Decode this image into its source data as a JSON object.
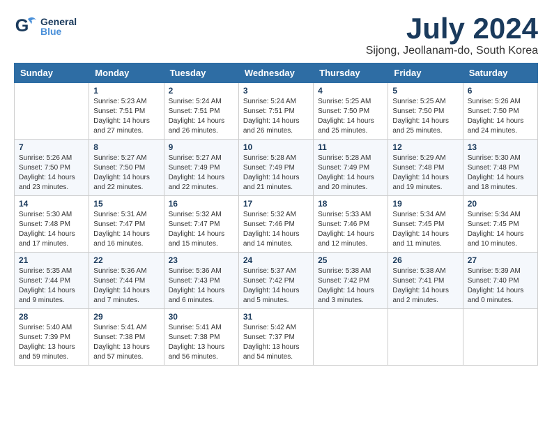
{
  "header": {
    "logo_general": "General",
    "logo_blue": "Blue",
    "month_title": "July 2024",
    "location": "Sijong, Jeollanam-do, South Korea"
  },
  "calendar": {
    "days_of_week": [
      "Sunday",
      "Monday",
      "Tuesday",
      "Wednesday",
      "Thursday",
      "Friday",
      "Saturday"
    ],
    "weeks": [
      [
        {
          "day": "",
          "content": ""
        },
        {
          "day": "1",
          "content": "Sunrise: 5:23 AM\nSunset: 7:51 PM\nDaylight: 14 hours\nand 27 minutes."
        },
        {
          "day": "2",
          "content": "Sunrise: 5:24 AM\nSunset: 7:51 PM\nDaylight: 14 hours\nand 26 minutes."
        },
        {
          "day": "3",
          "content": "Sunrise: 5:24 AM\nSunset: 7:51 PM\nDaylight: 14 hours\nand 26 minutes."
        },
        {
          "day": "4",
          "content": "Sunrise: 5:25 AM\nSunset: 7:50 PM\nDaylight: 14 hours\nand 25 minutes."
        },
        {
          "day": "5",
          "content": "Sunrise: 5:25 AM\nSunset: 7:50 PM\nDaylight: 14 hours\nand 25 minutes."
        },
        {
          "day": "6",
          "content": "Sunrise: 5:26 AM\nSunset: 7:50 PM\nDaylight: 14 hours\nand 24 minutes."
        }
      ],
      [
        {
          "day": "7",
          "content": "Sunrise: 5:26 AM\nSunset: 7:50 PM\nDaylight: 14 hours\nand 23 minutes."
        },
        {
          "day": "8",
          "content": "Sunrise: 5:27 AM\nSunset: 7:50 PM\nDaylight: 14 hours\nand 22 minutes."
        },
        {
          "day": "9",
          "content": "Sunrise: 5:27 AM\nSunset: 7:49 PM\nDaylight: 14 hours\nand 22 minutes."
        },
        {
          "day": "10",
          "content": "Sunrise: 5:28 AM\nSunset: 7:49 PM\nDaylight: 14 hours\nand 21 minutes."
        },
        {
          "day": "11",
          "content": "Sunrise: 5:28 AM\nSunset: 7:49 PM\nDaylight: 14 hours\nand 20 minutes."
        },
        {
          "day": "12",
          "content": "Sunrise: 5:29 AM\nSunset: 7:48 PM\nDaylight: 14 hours\nand 19 minutes."
        },
        {
          "day": "13",
          "content": "Sunrise: 5:30 AM\nSunset: 7:48 PM\nDaylight: 14 hours\nand 18 minutes."
        }
      ],
      [
        {
          "day": "14",
          "content": "Sunrise: 5:30 AM\nSunset: 7:48 PM\nDaylight: 14 hours\nand 17 minutes."
        },
        {
          "day": "15",
          "content": "Sunrise: 5:31 AM\nSunset: 7:47 PM\nDaylight: 14 hours\nand 16 minutes."
        },
        {
          "day": "16",
          "content": "Sunrise: 5:32 AM\nSunset: 7:47 PM\nDaylight: 14 hours\nand 15 minutes."
        },
        {
          "day": "17",
          "content": "Sunrise: 5:32 AM\nSunset: 7:46 PM\nDaylight: 14 hours\nand 14 minutes."
        },
        {
          "day": "18",
          "content": "Sunrise: 5:33 AM\nSunset: 7:46 PM\nDaylight: 14 hours\nand 12 minutes."
        },
        {
          "day": "19",
          "content": "Sunrise: 5:34 AM\nSunset: 7:45 PM\nDaylight: 14 hours\nand 11 minutes."
        },
        {
          "day": "20",
          "content": "Sunrise: 5:34 AM\nSunset: 7:45 PM\nDaylight: 14 hours\nand 10 minutes."
        }
      ],
      [
        {
          "day": "21",
          "content": "Sunrise: 5:35 AM\nSunset: 7:44 PM\nDaylight: 14 hours\nand 9 minutes."
        },
        {
          "day": "22",
          "content": "Sunrise: 5:36 AM\nSunset: 7:44 PM\nDaylight: 14 hours\nand 7 minutes."
        },
        {
          "day": "23",
          "content": "Sunrise: 5:36 AM\nSunset: 7:43 PM\nDaylight: 14 hours\nand 6 minutes."
        },
        {
          "day": "24",
          "content": "Sunrise: 5:37 AM\nSunset: 7:42 PM\nDaylight: 14 hours\nand 5 minutes."
        },
        {
          "day": "25",
          "content": "Sunrise: 5:38 AM\nSunset: 7:42 PM\nDaylight: 14 hours\nand 3 minutes."
        },
        {
          "day": "26",
          "content": "Sunrise: 5:38 AM\nSunset: 7:41 PM\nDaylight: 14 hours\nand 2 minutes."
        },
        {
          "day": "27",
          "content": "Sunrise: 5:39 AM\nSunset: 7:40 PM\nDaylight: 14 hours\nand 0 minutes."
        }
      ],
      [
        {
          "day": "28",
          "content": "Sunrise: 5:40 AM\nSunset: 7:39 PM\nDaylight: 13 hours\nand 59 minutes."
        },
        {
          "day": "29",
          "content": "Sunrise: 5:41 AM\nSunset: 7:38 PM\nDaylight: 13 hours\nand 57 minutes."
        },
        {
          "day": "30",
          "content": "Sunrise: 5:41 AM\nSunset: 7:38 PM\nDaylight: 13 hours\nand 56 minutes."
        },
        {
          "day": "31",
          "content": "Sunrise: 5:42 AM\nSunset: 7:37 PM\nDaylight: 13 hours\nand 54 minutes."
        },
        {
          "day": "",
          "content": ""
        },
        {
          "day": "",
          "content": ""
        },
        {
          "day": "",
          "content": ""
        }
      ]
    ]
  }
}
